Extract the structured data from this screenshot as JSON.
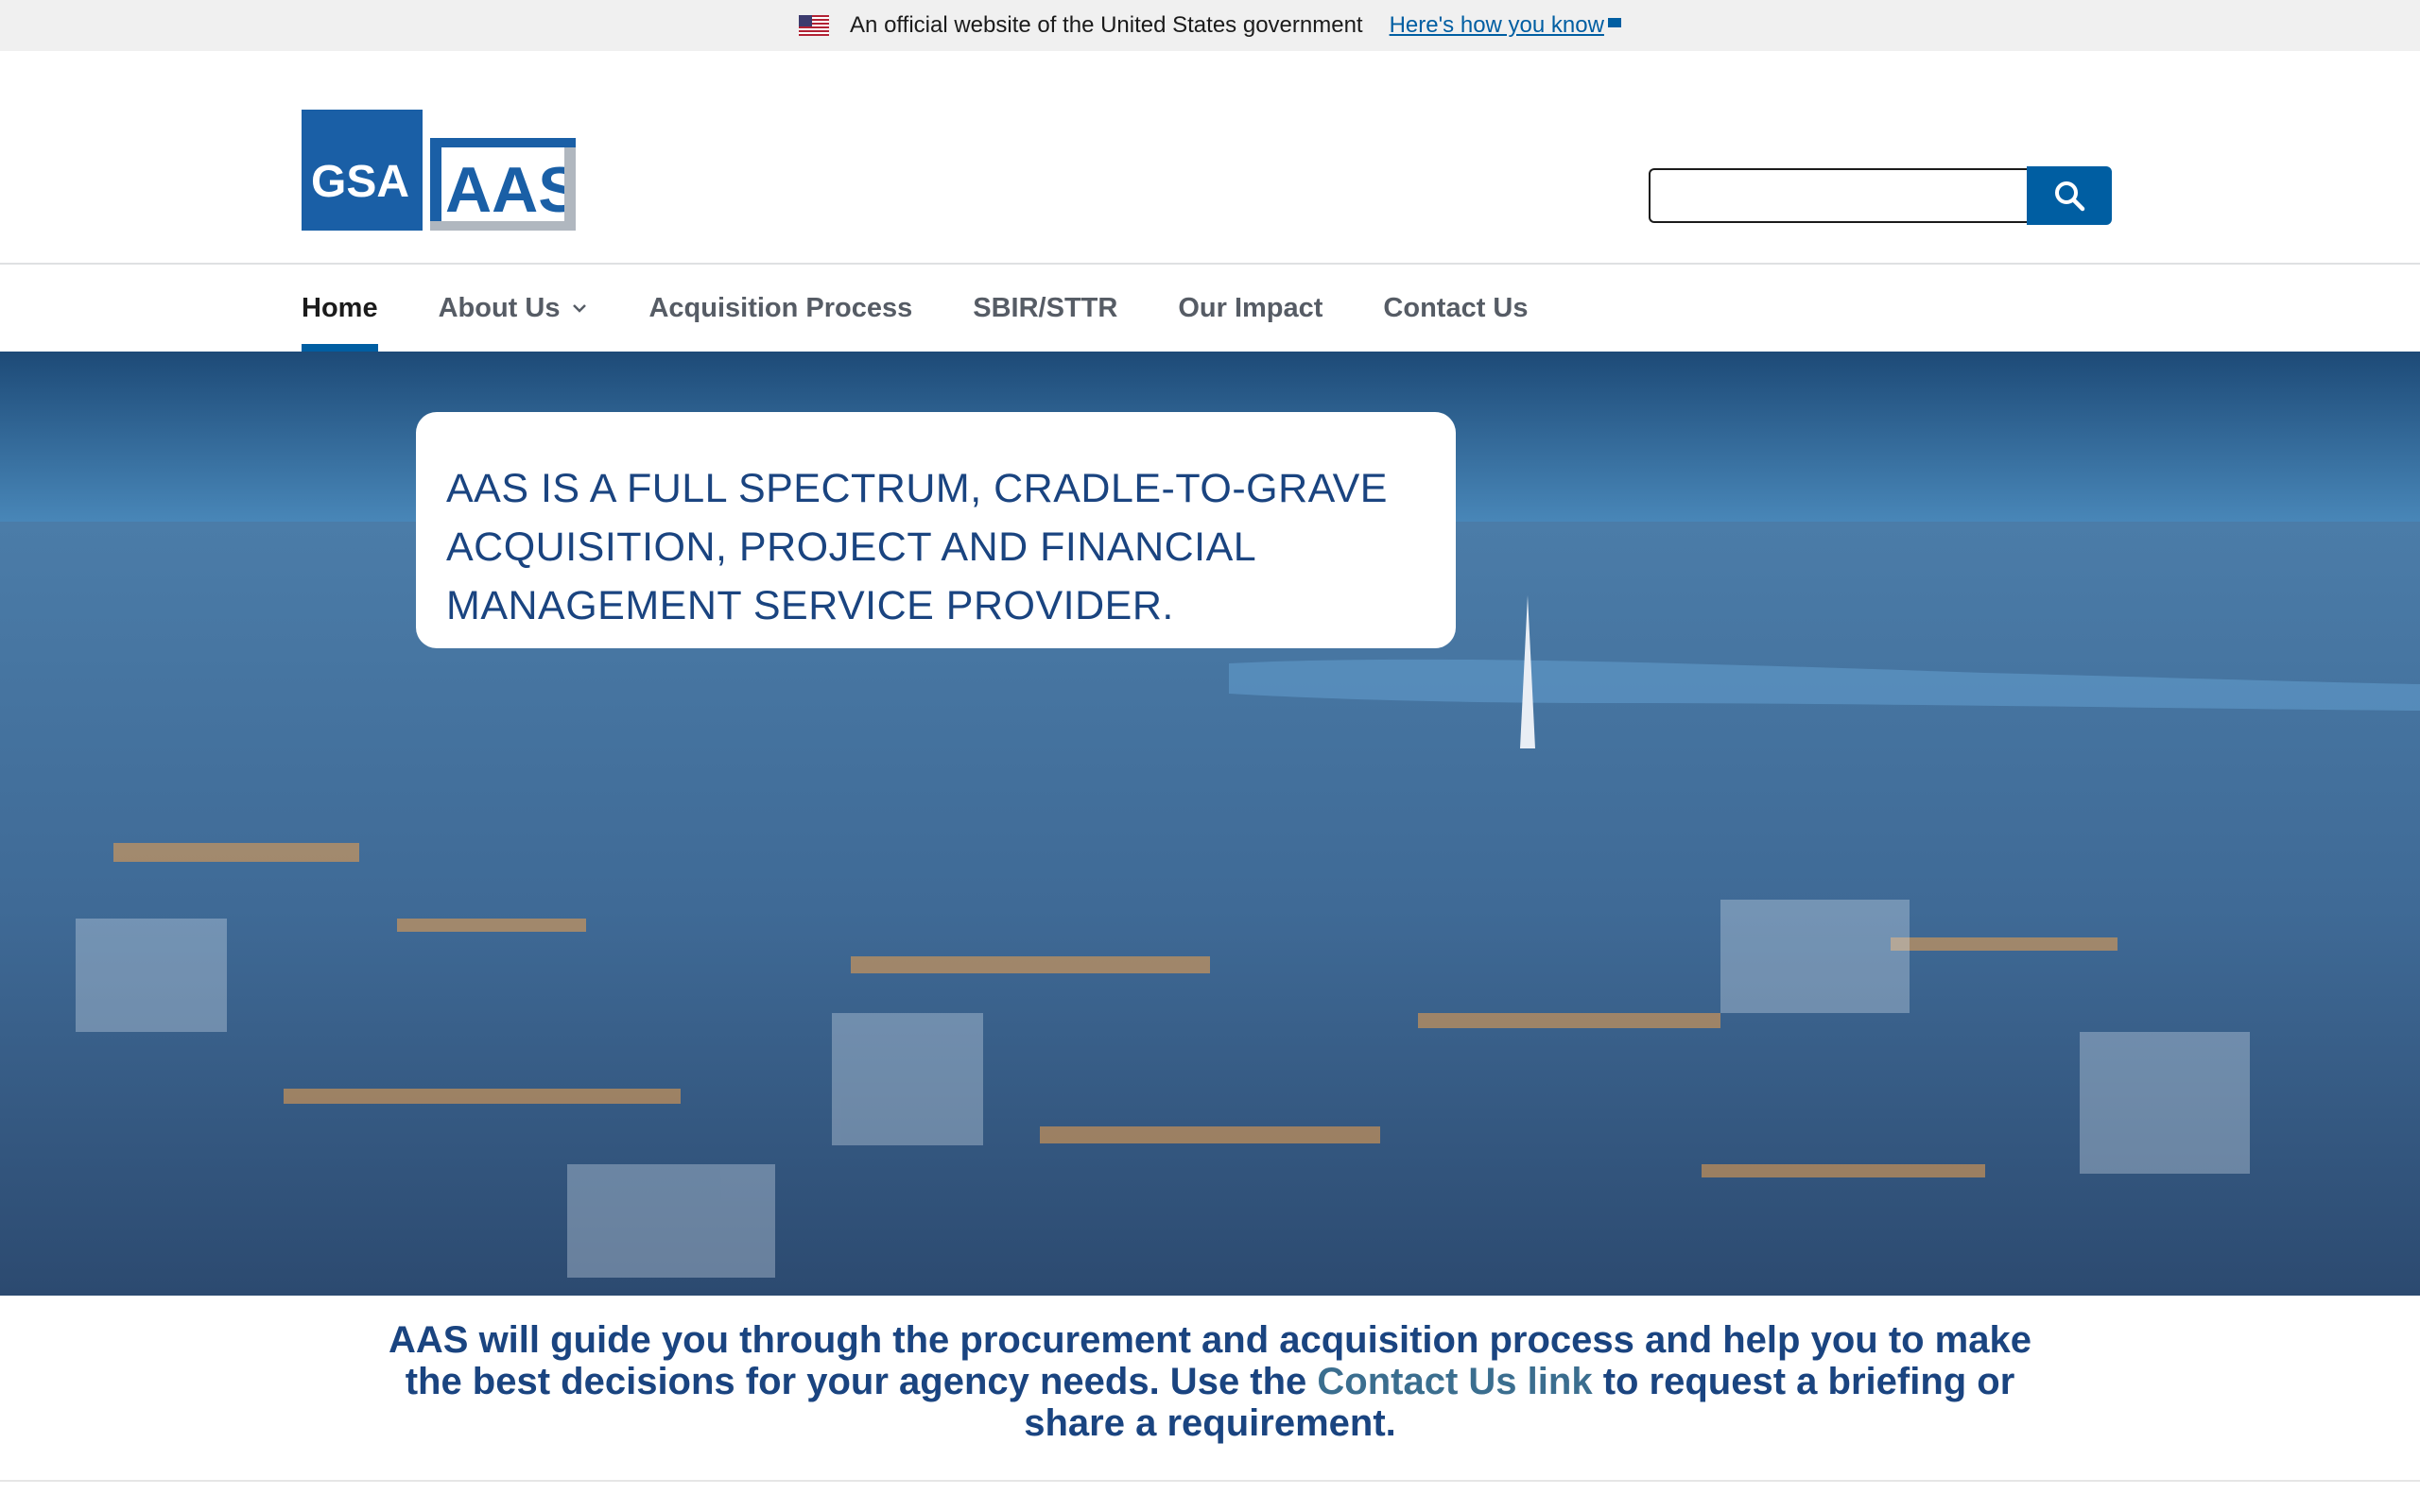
{
  "gov_banner": {
    "official_text": "An official website of the United States government",
    "how_link": "Here's how you know"
  },
  "header": {
    "logo": {
      "gsa_text": "GSA",
      "aas_text": "AAS",
      "alt": "GSA AAS"
    },
    "search": {
      "placeholder": "",
      "value": ""
    }
  },
  "nav": {
    "items": [
      {
        "label": "Home",
        "active": true
      },
      {
        "label": "About Us",
        "has_dropdown": true
      },
      {
        "label": "Acquisition Process"
      },
      {
        "label": "SBIR/STTR"
      },
      {
        "label": "Our Impact"
      },
      {
        "label": "Contact Us"
      }
    ]
  },
  "hero": {
    "headline": "AAS IS A FULL SPECTRUM, CRADLE-TO-GRAVE ACQUISITION, PROJECT AND FINANCIAL MANAGEMENT SERVICE PROVIDER."
  },
  "intro": {
    "text_before": "AAS will guide you through the procurement and acquisition process and help you to make the best decisions for your agency needs. Use the ",
    "link_text": "Contact Us link",
    "text_after": " to request a briefing or share a requirement."
  },
  "colors": {
    "primary": "#005ea2",
    "headline": "#1a4480",
    "link": "#3b6e8f",
    "banner_bg": "#f0f0f0"
  }
}
